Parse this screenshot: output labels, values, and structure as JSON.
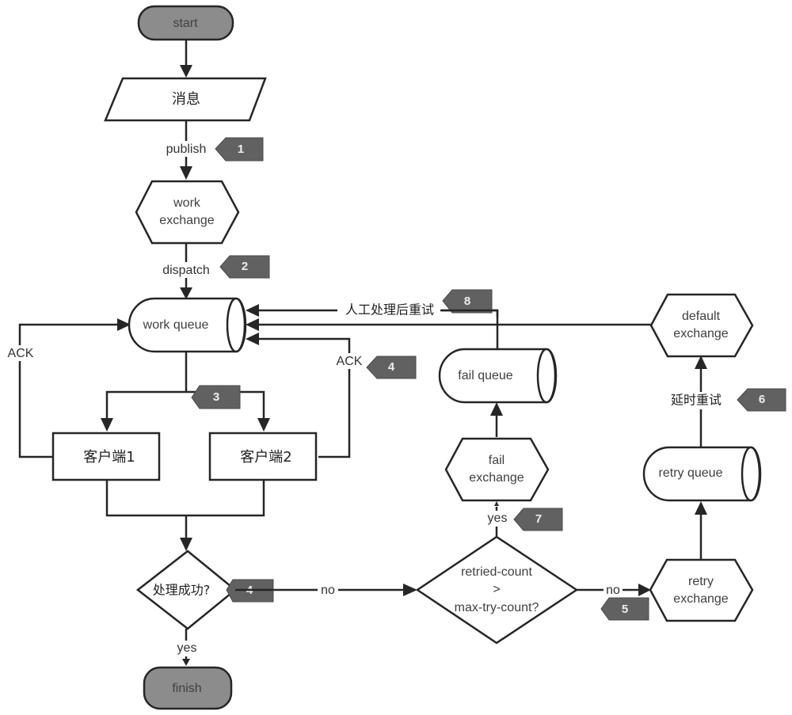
{
  "diagram": {
    "nodes": {
      "start": "start",
      "message": "消息",
      "work_exchange": [
        "work",
        "exchange"
      ],
      "work_queue": "work queue",
      "client1": "客户端1",
      "client2": "客户端2",
      "process_success": "处理成功?",
      "finish": "finish",
      "retry_check": [
        "retried-count",
        ">",
        "max-try-count?"
      ],
      "fail_exchange": [
        "fail",
        "exchange"
      ],
      "fail_queue": "fail queue",
      "retry_exchange": [
        "retry",
        "exchange"
      ],
      "retry_queue": "retry queue",
      "default_exchange": [
        "default",
        "exchange"
      ]
    },
    "edges": {
      "publish": "publish",
      "dispatch": "dispatch",
      "ack_left": "ACK",
      "ack_right": "ACK",
      "manual_retry": "人工处理后重试",
      "delay_retry": "延时重试",
      "yes_finish": "yes",
      "no_check": "no",
      "yes_fail": "yes",
      "no_retry": "no"
    },
    "step_tags": {
      "t1": "1",
      "t2": "2",
      "t3": "3",
      "t4a": "4",
      "t4b": "4",
      "t5": "5",
      "t6": "6",
      "t7": "7",
      "t8": "8"
    }
  }
}
